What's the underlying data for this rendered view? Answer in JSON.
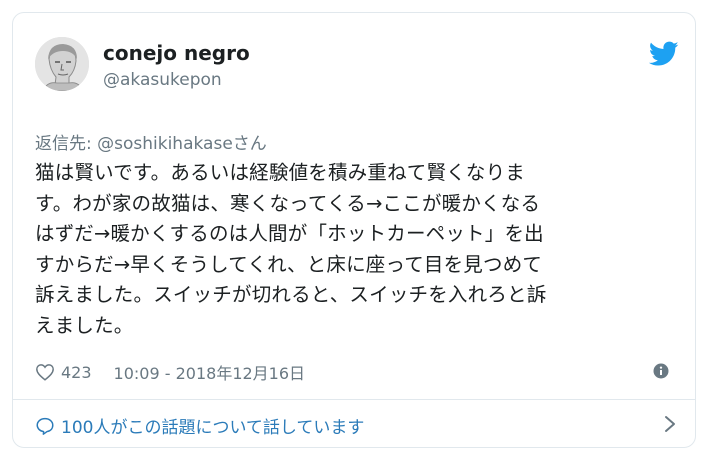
{
  "user": {
    "display_name": "conejo negro",
    "handle": "@akasukepon"
  },
  "tweet": {
    "reply_line": "返信先: @soshikihakaseさん",
    "lines": [
      "猫は賢いです。あるいは経験値を積み重ねて賢くなりま",
      "す。わが家の故猫は、寒くなってくる→ここが暖かくなる",
      "はずだ→暖かくするのは人間が「ホットカーペット」を出",
      "すからだ→早くそうしてくれ、と床に座って目を見つめて",
      "訴えました。スイッチが切れると、スイッチを入れろと訴",
      "えました。"
    ],
    "likes": "423",
    "timestamp": "10:09 - 2018年12月16日"
  },
  "conversation": {
    "label": "100人がこの話題について話しています"
  },
  "icons": {
    "brand": "twitter-bird-icon",
    "like": "heart-icon",
    "info": "info-icon",
    "conversation": "speech-bubble-icon",
    "expand": "chevron-right-icon"
  },
  "colors": {
    "twitter_blue": "#1da1f2",
    "link_blue": "#2b7bb9",
    "secondary_text": "#697882",
    "border": "#e1e8ed"
  }
}
